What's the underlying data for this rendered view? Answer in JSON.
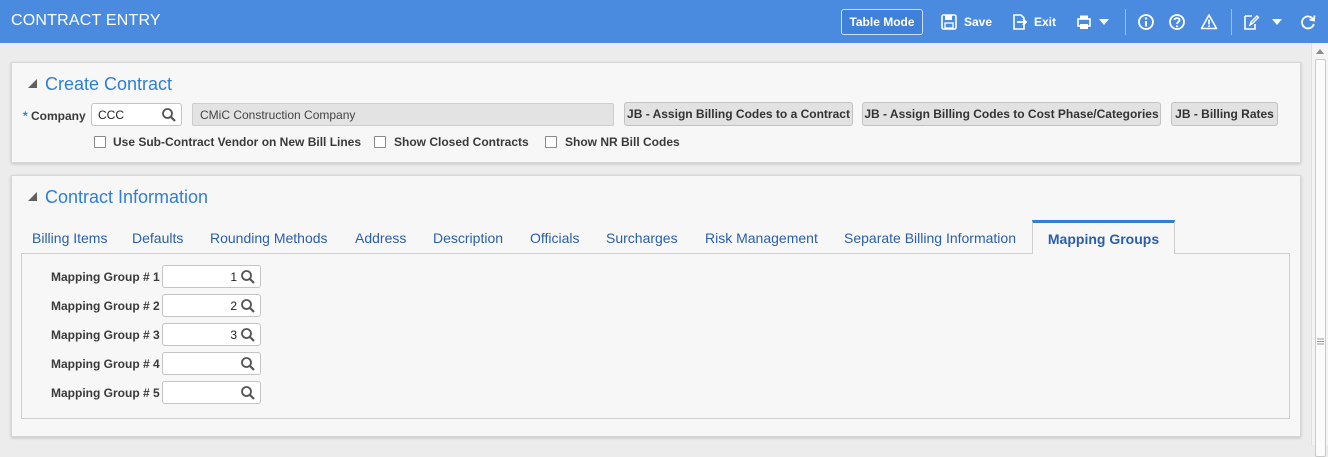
{
  "app": {
    "title": "CONTRACT ENTRY"
  },
  "toolbar": {
    "table_mode_label": "Table Mode",
    "save_label": "Save",
    "exit_label": "Exit"
  },
  "create_contract": {
    "title": "Create Contract",
    "company_required_mark": "*",
    "company_label": "Company",
    "company_value": "CCC",
    "company_name": "CMiC Construction Company",
    "buttons": {
      "assign_codes_contract": "JB - Assign Billing Codes to a Contract",
      "assign_codes_cost": "JB - Assign Billing Codes to Cost Phase/Categories",
      "billing_rates": "JB - Billing Rates"
    },
    "checkboxes": {
      "subcontract_vendor": "Use Sub-Contract Vendor on New Bill Lines",
      "show_closed": "Show Closed Contracts",
      "show_nr": "Show NR Bill Codes"
    }
  },
  "contract_info": {
    "title": "Contract Information",
    "tabs": [
      {
        "label": "Billing Items"
      },
      {
        "label": "Defaults"
      },
      {
        "label": "Rounding Methods"
      },
      {
        "label": "Address"
      },
      {
        "label": "Description"
      },
      {
        "label": "Officials"
      },
      {
        "label": "Surcharges"
      },
      {
        "label": "Risk Management"
      },
      {
        "label": "Separate Billing Information"
      },
      {
        "label": "Mapping Groups"
      }
    ],
    "mapping_groups": [
      {
        "label": "Mapping Group # 1",
        "value": "1"
      },
      {
        "label": "Mapping Group # 2",
        "value": "2"
      },
      {
        "label": "Mapping Group # 3",
        "value": "3"
      },
      {
        "label": "Mapping Group # 4",
        "value": ""
      },
      {
        "label": "Mapping Group # 5",
        "value": ""
      }
    ]
  },
  "colors": {
    "header_bg": "#4a8be0",
    "accent": "#2f7fd4",
    "tab_text": "#2a5fa8"
  }
}
